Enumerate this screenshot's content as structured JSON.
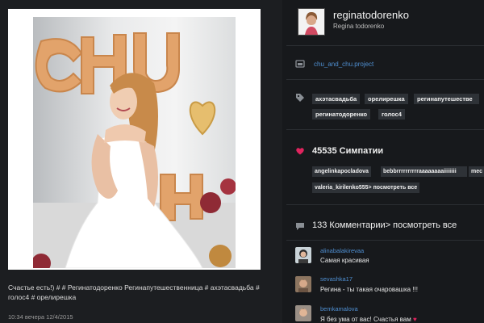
{
  "post": {
    "caption": "Счастье есть!) # # Регинатодоренко Регинапутешественница # ахэтасвадьба # голос4 # орелирешка",
    "timestamp": "10:34 вечера 12/4/2015",
    "balloon_text": "CHU"
  },
  "profile": {
    "username": "reginatodorenko",
    "full_name": "Regina todorenko",
    "avatar_icon": "profile-photo"
  },
  "location": {
    "icon": "location-pin-icon",
    "text": "chu_and_chu.project"
  },
  "tags": {
    "icon": "tag-icon",
    "items": [
      "ахэтасвадьба",
      "орелирешка",
      "регинапутешестве",
      "регинатодоренко",
      "голос4"
    ]
  },
  "likes": {
    "icon": "heart-icon",
    "count_text": "45535 Симпатии",
    "likers": [
      "angelinkapocladova",
      "bebbrrrrrrrrrraaaaaaaaiiiiiiii",
      "mec",
      "valeria_kirilenko555> посмотреть все"
    ]
  },
  "comments": {
    "icon": "comment-icon",
    "header": "133 Комментарии> посмотреть все",
    "items": [
      {
        "user": "alinabalakirevaa",
        "text": "Самая красивая"
      },
      {
        "user": "sevashka17",
        "text": "Регина - ты такая очаровашка !!!"
      },
      {
        "user": "bemkamalova",
        "text": "Я без ума от вас! Счастья вам"
      }
    ]
  },
  "colors": {
    "background": "#17191c",
    "link": "#4f8fd1",
    "heart": "#e0245e",
    "tag_bg": "#2e3237"
  }
}
